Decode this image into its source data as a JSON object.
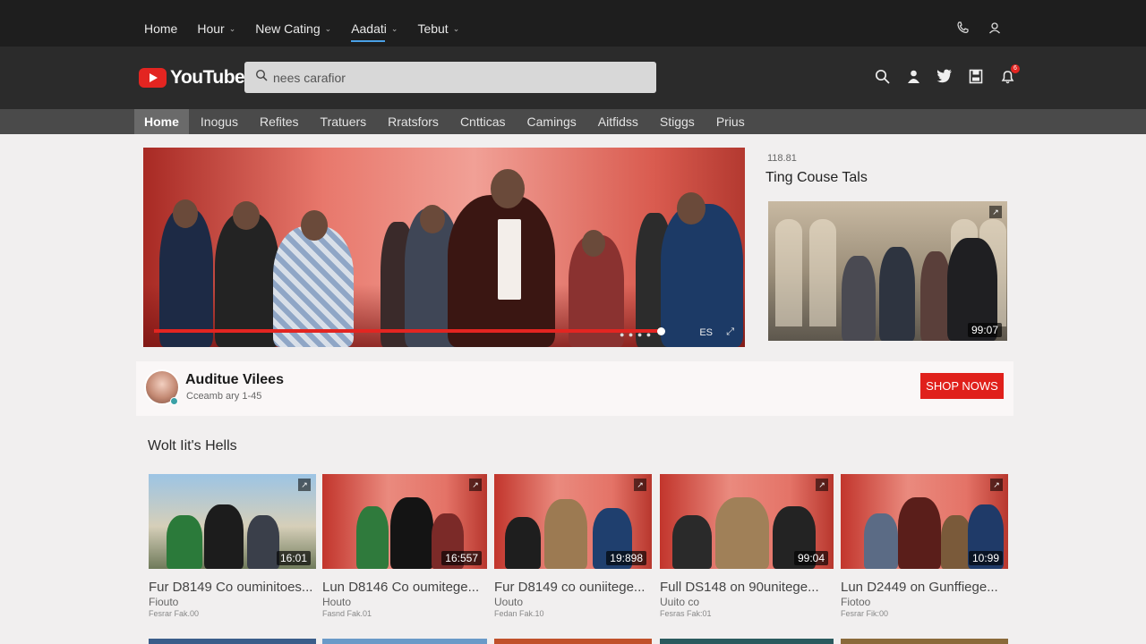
{
  "topnav": {
    "links": [
      {
        "label": "Home",
        "dropdown": false
      },
      {
        "label": "Hour",
        "dropdown": true
      },
      {
        "label": "New Cating",
        "dropdown": true
      },
      {
        "label": "Aadati",
        "dropdown": true,
        "active": true
      },
      {
        "label": "Tebut",
        "dropdown": true
      }
    ],
    "icons": [
      "phone-icon",
      "user-icon"
    ]
  },
  "header": {
    "logo_text": "YouTube",
    "search_placeholder": "nees carafior",
    "icons": [
      "search-icon",
      "people-icon",
      "twitter-icon",
      "save-icon",
      "notification-icon"
    ],
    "notification_badge": "6"
  },
  "categories": [
    "Home",
    "Inogus",
    "Refites",
    "Tratuers",
    "Rratsfors",
    "Cntticas",
    "Camings",
    "Aitfidss",
    "Stiggs",
    "Prius"
  ],
  "hero": {
    "ctrl_labels": [
      "ES",
      "⤢"
    ],
    "progress": 0.89
  },
  "side": {
    "meta": "118.81",
    "title": "Ting Couse Tals",
    "duration": "99:07"
  },
  "channel": {
    "name": "Auditue Vilees",
    "subtitle": "Cceamb ary 1-45",
    "cta": "SHOP NOWS"
  },
  "section": {
    "title": "Wolt Iit's Hells",
    "videos": [
      {
        "title": "Fur D8149 Co ouminitoes...",
        "sub": "Fiouto",
        "meta": "Fesrar Fak.00",
        "duration": "16:01"
      },
      {
        "title": "Lun D8146 Co oumitege...",
        "sub": "Houto",
        "meta": "Fasnd Fak.01",
        "duration": "16:557"
      },
      {
        "title": "Fur D8149 co ouniitege...",
        "sub": "Uouto",
        "meta": "Fedan Fak.10",
        "duration": "19:898"
      },
      {
        "title": "Full DS148 on 90unitege...",
        "sub": "Uuito co",
        "meta": "Fesras Fak:01",
        "duration": "99:04"
      },
      {
        "title": "Lun D2449 on Gunffiege...",
        "sub": "Fiotoo",
        "meta": "Fesrar Fik:00",
        "duration": "10:99"
      }
    ]
  },
  "colors": {
    "accent": "#e32521",
    "topnav_bg": "#1e1e1e",
    "header_bg": "#2b2b2b",
    "catbar_bg": "#4a4a4a"
  }
}
